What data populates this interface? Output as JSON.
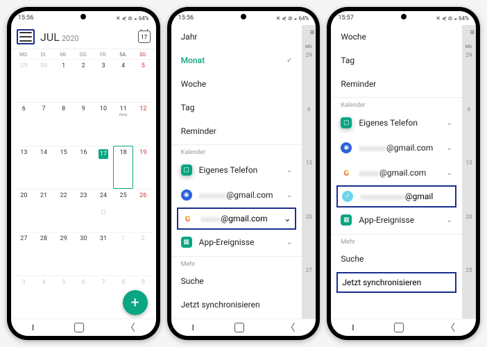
{
  "status": {
    "time": "15:56",
    "time3": "15:57",
    "battery": "64%",
    "icons": "✕ ⋞ ⊘ ◒"
  },
  "header": {
    "month": "JUL",
    "year": "2020",
    "today": "17"
  },
  "dow": [
    "MO.",
    "DI.",
    "MI.",
    "DO.",
    "FR.",
    "SA.",
    "SO."
  ],
  "days": [
    {
      "n": "29",
      "off": true
    },
    {
      "n": "30",
      "off": true
    },
    {
      "n": "1"
    },
    {
      "n": "2"
    },
    {
      "n": "3"
    },
    {
      "n": "4"
    },
    {
      "n": "5",
      "sun": true
    },
    {
      "n": "6"
    },
    {
      "n": "7"
    },
    {
      "n": "8"
    },
    {
      "n": "9"
    },
    {
      "n": "10"
    },
    {
      "n": "11",
      "evt": "Party"
    },
    {
      "n": "12",
      "sun": true
    },
    {
      "n": "13"
    },
    {
      "n": "14"
    },
    {
      "n": "15"
    },
    {
      "n": "16"
    },
    {
      "n": "17",
      "today": true
    },
    {
      "n": "18",
      "selected": true
    },
    {
      "n": "19",
      "sun": true
    },
    {
      "n": "20"
    },
    {
      "n": "21"
    },
    {
      "n": "22"
    },
    {
      "n": "23"
    },
    {
      "n": "24",
      "sticker": true
    },
    {
      "n": "25"
    },
    {
      "n": "26",
      "sun": true
    },
    {
      "n": "27"
    },
    {
      "n": "28"
    },
    {
      "n": "29"
    },
    {
      "n": "30"
    },
    {
      "n": "31"
    },
    {
      "n": "1",
      "off": true
    },
    {
      "n": "2",
      "off": true,
      "sun": true
    },
    {
      "n": "3",
      "off": true
    },
    {
      "n": "4",
      "off": true
    },
    {
      "n": "5",
      "off": true
    },
    {
      "n": "6",
      "off": true
    },
    {
      "n": "7",
      "off": true
    },
    {
      "n": "8",
      "off": true
    },
    {
      "n": "9",
      "off": true,
      "sun": true
    }
  ],
  "drawer": {
    "jahr": "Jahr",
    "monat": "Monat",
    "woche": "Woche",
    "tag": "Tag",
    "reminder": "Reminder",
    "section_kalender": "Kalender",
    "eigenes": "Eigenes Telefon",
    "gmail_suffix": "@gmail.com",
    "gmail_short": "@gmail",
    "app_ereignisse": "App-Ereignisse",
    "section_mehr": "Mehr",
    "suche": "Suche",
    "sync": "Jetzt synchronisieren"
  },
  "side": {
    "mo": "MO.",
    "d29": "29",
    "d6": "6",
    "d13": "13",
    "d20": "20",
    "d25": "25",
    "d27": "27"
  }
}
